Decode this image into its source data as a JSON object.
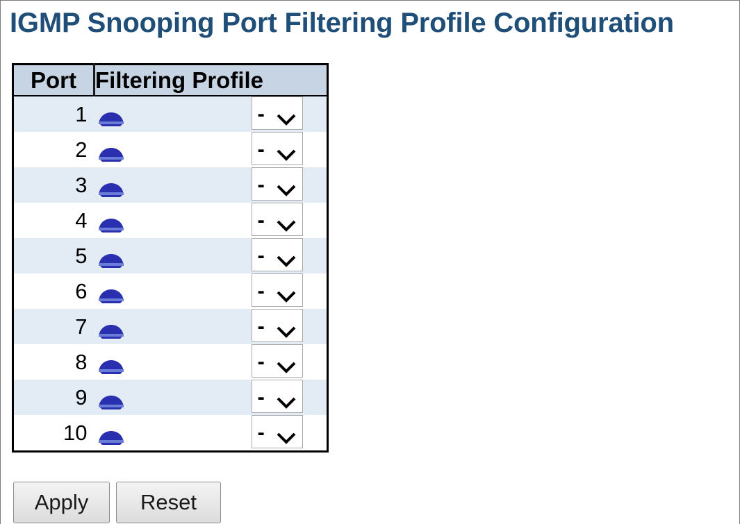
{
  "page": {
    "title": "IGMP Snooping Port Filtering Profile Configuration"
  },
  "table": {
    "headers": {
      "port": "Port",
      "filtering_profile": "Filtering Profile"
    },
    "rows": [
      {
        "port": "1",
        "profile": "-"
      },
      {
        "port": "2",
        "profile": "-"
      },
      {
        "port": "3",
        "profile": "-"
      },
      {
        "port": "4",
        "profile": "-"
      },
      {
        "port": "5",
        "profile": "-"
      },
      {
        "port": "6",
        "profile": "-"
      },
      {
        "port": "7",
        "profile": "-"
      },
      {
        "port": "8",
        "profile": "-"
      },
      {
        "port": "9",
        "profile": "-"
      },
      {
        "port": "10",
        "profile": "-"
      }
    ],
    "row_icon": "profile-dome-icon"
  },
  "buttons": {
    "apply": "Apply",
    "reset": "Reset"
  },
  "colors": {
    "title": "#1f4e79",
    "header_bg": "#c6d4e4",
    "row_odd_bg": "#e3ebf4",
    "row_even_bg": "#ffffff",
    "icon": "#2a2fb0"
  }
}
